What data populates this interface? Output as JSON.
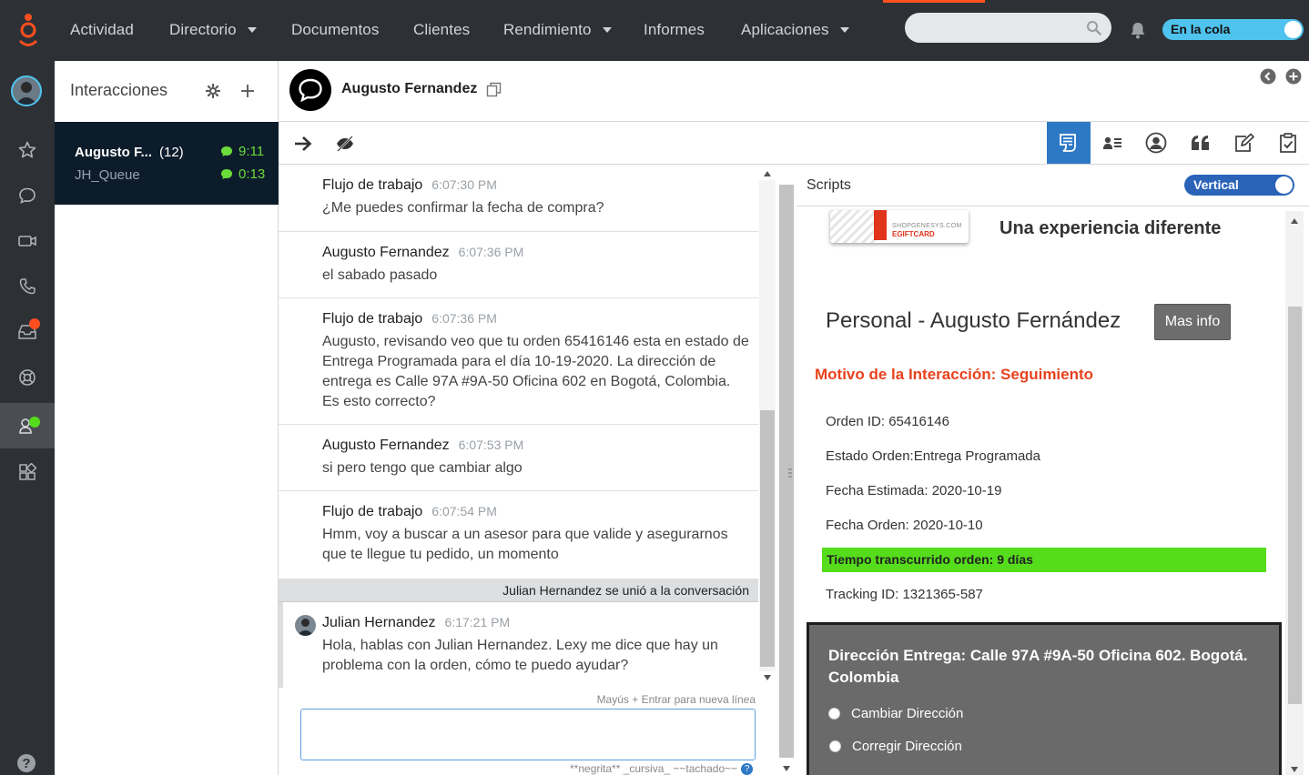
{
  "nav": {
    "items": [
      {
        "label": "Actividad"
      },
      {
        "label": "Directorio"
      },
      {
        "label": "Documentos"
      },
      {
        "label": "Clientes"
      },
      {
        "label": "Rendimiento"
      },
      {
        "label": "Informes"
      },
      {
        "label": "Aplicaciones"
      }
    ],
    "search_placeholder": "",
    "status_toggle_label": "En la cola"
  },
  "colors": {
    "topbar": "#2d3136",
    "accent_orange": "#ff4f1f",
    "active_tab_blue": "#2e79c5",
    "status_toggle": "#4fc3ee",
    "green_time": "#6bdc3a",
    "motivo_red": "#e8421e",
    "elapsed_green": "#55dd1b"
  },
  "sidebar": {
    "icons": [
      "star-icon",
      "chat-icon",
      "video-icon",
      "phone-icon",
      "inbox-icon",
      "support-icon",
      "agent-icon",
      "apps-icon",
      "help-icon"
    ],
    "help_label": "?"
  },
  "interactions": {
    "title": "Interacciones",
    "card": {
      "name": "Augusto F...",
      "count": "(12)",
      "queue": "JH_Queue",
      "time1": "9:11",
      "time2": "0:13"
    }
  },
  "conversation": {
    "contact_name": "Augusto Fernandez",
    "messages": [
      {
        "author": "Flujo de trabajo",
        "time": "6:07:30 PM",
        "text": "¿Me puedes confirmar la fecha de compra?"
      },
      {
        "author": "Augusto Fernandez",
        "time": "6:07:36 PM",
        "text": "el sabado pasado"
      },
      {
        "author": "Flujo de trabajo",
        "time": "6:07:36 PM",
        "text": "Augusto, revisando veo que tu orden 65416146 esta en estado de Entrega Programada para el día 10-19-2020. La dirección de entrega es Calle 97A #9A-50 Oficina 602 en Bogotá, Colombia. Es esto correcto?"
      },
      {
        "author": "Augusto Fernandez",
        "time": "6:07:53 PM",
        "text": "si pero tengo que cambiar algo"
      },
      {
        "author": "Flujo de trabajo",
        "time": "6:07:54 PM",
        "text": "Hmm, voy a buscar a un asesor para que valide y asegurarnos que te llegue tu pedido, un momento"
      }
    ],
    "joined_notice": "Julian Hernandez se unió a la conversación",
    "agent_message": {
      "author": "Julian Hernandez",
      "time": "6:17:21 PM",
      "text": "Hola, hablas con Julian Hernandez. Lexy me dice que hay un problema con la orden, cómo te puedo ayudar?"
    },
    "composer": {
      "hint": "Mayús + Entrar para nueva línea",
      "value": "",
      "format_hint": "**negrita** _cursiva_ ~~tachado~~",
      "help": "?"
    }
  },
  "scripts": {
    "title": "Scripts",
    "layout_toggle": "Vertical",
    "giftcard_line1": "SHOPGENESYS.COM",
    "giftcard_line2": "EGIFTCARD",
    "tagline": "Una experiencia diferente",
    "person": "Personal - Augusto Fernández",
    "more_info_button": "Mas info",
    "motivo": "Motivo de la Interacción: Seguimiento",
    "fields": {
      "orden_id": "Orden ID: 65416146",
      "estado": "Estado Orden:Entrega Programada",
      "fecha_estimada": "Fecha Estimada: 2020-10-19",
      "fecha_orden": "Fecha Orden: 2020-10-10",
      "tiempo": "Tiempo transcurrido orden: 9 días",
      "tracking": "Tracking ID: 1321365-587"
    },
    "address": "Dirección Entrega: Calle 97A #9A-50 Oficina 602. Bogotá. Colombia",
    "options": [
      "Cambiar Dirección",
      "Corregir Dirección"
    ]
  }
}
